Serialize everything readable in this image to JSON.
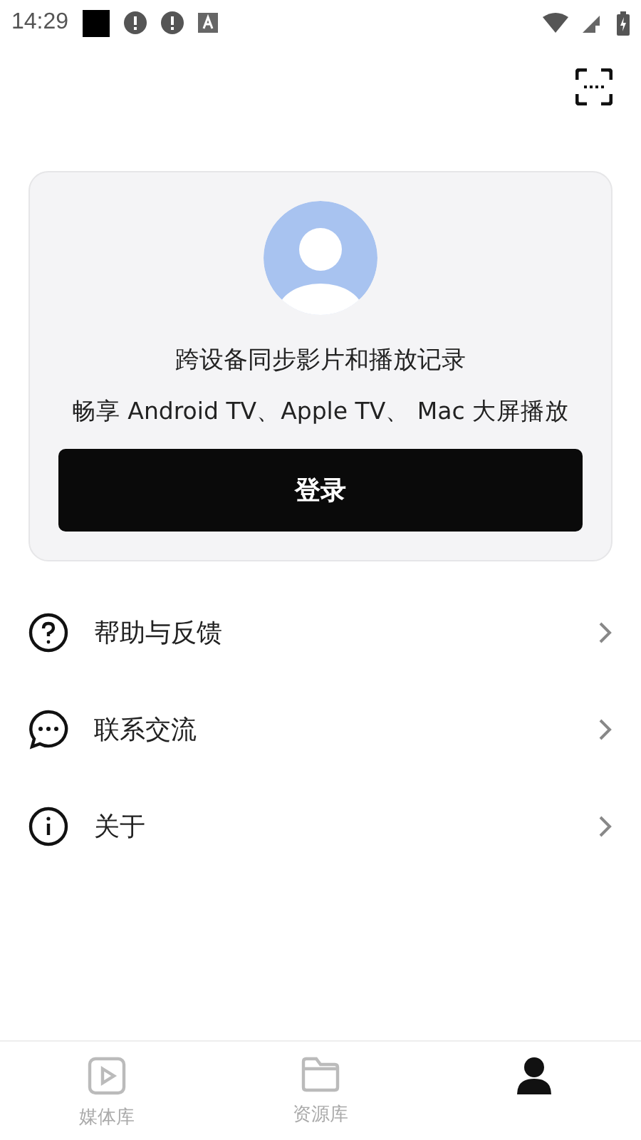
{
  "status_bar": {
    "time": "14:29"
  },
  "account_card": {
    "line_1": "跨设备同步影片和播放记录",
    "line_2": "畅享 Android TV、Apple TV、 Mac 大屏播放",
    "login_button": "登录"
  },
  "menu": [
    {
      "kind": "help",
      "label": "帮助与反馈"
    },
    {
      "kind": "chat",
      "label": "联系交流"
    },
    {
      "kind": "info",
      "label": "关于"
    }
  ],
  "tabs": [
    {
      "kind": "video",
      "label": "媒体库",
      "selected": false
    },
    {
      "kind": "folder",
      "label": "资源库",
      "selected": false
    },
    {
      "kind": "person",
      "selected": true
    }
  ]
}
